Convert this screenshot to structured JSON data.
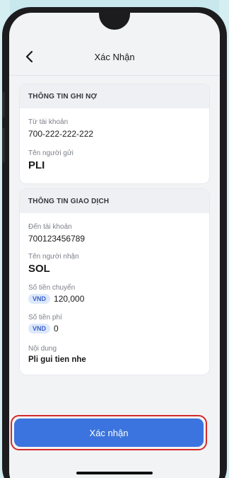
{
  "header": {
    "title": "Xác Nhận",
    "back_icon": "chevron-left-icon"
  },
  "debit_section": {
    "heading": "THÔNG TIN GHI NỢ",
    "from_account_label": "Từ tài khoản",
    "from_account_value": "700-222-222-222",
    "sender_label": "Tên người gửi",
    "sender_value": "PLI"
  },
  "transaction_section": {
    "heading": "THÔNG TIN GIAO DỊCH",
    "to_account_label": "Đến tài khoản",
    "to_account_value": "700123456789",
    "recipient_label": "Tên người nhận",
    "recipient_value": "SOL",
    "amount_label": "Số tiền chuyển",
    "amount_currency": "VND",
    "amount_value": "120,000",
    "fee_label": "Số tiền phí",
    "fee_currency": "VND",
    "fee_value": "0",
    "content_label": "Nội dung",
    "content_value": "Pli gui tien nhe"
  },
  "footer": {
    "confirm_label": "Xác nhận"
  },
  "colors": {
    "accent": "#3b74de",
    "highlight": "#d42a2a",
    "badge_bg": "#dde8fb"
  }
}
